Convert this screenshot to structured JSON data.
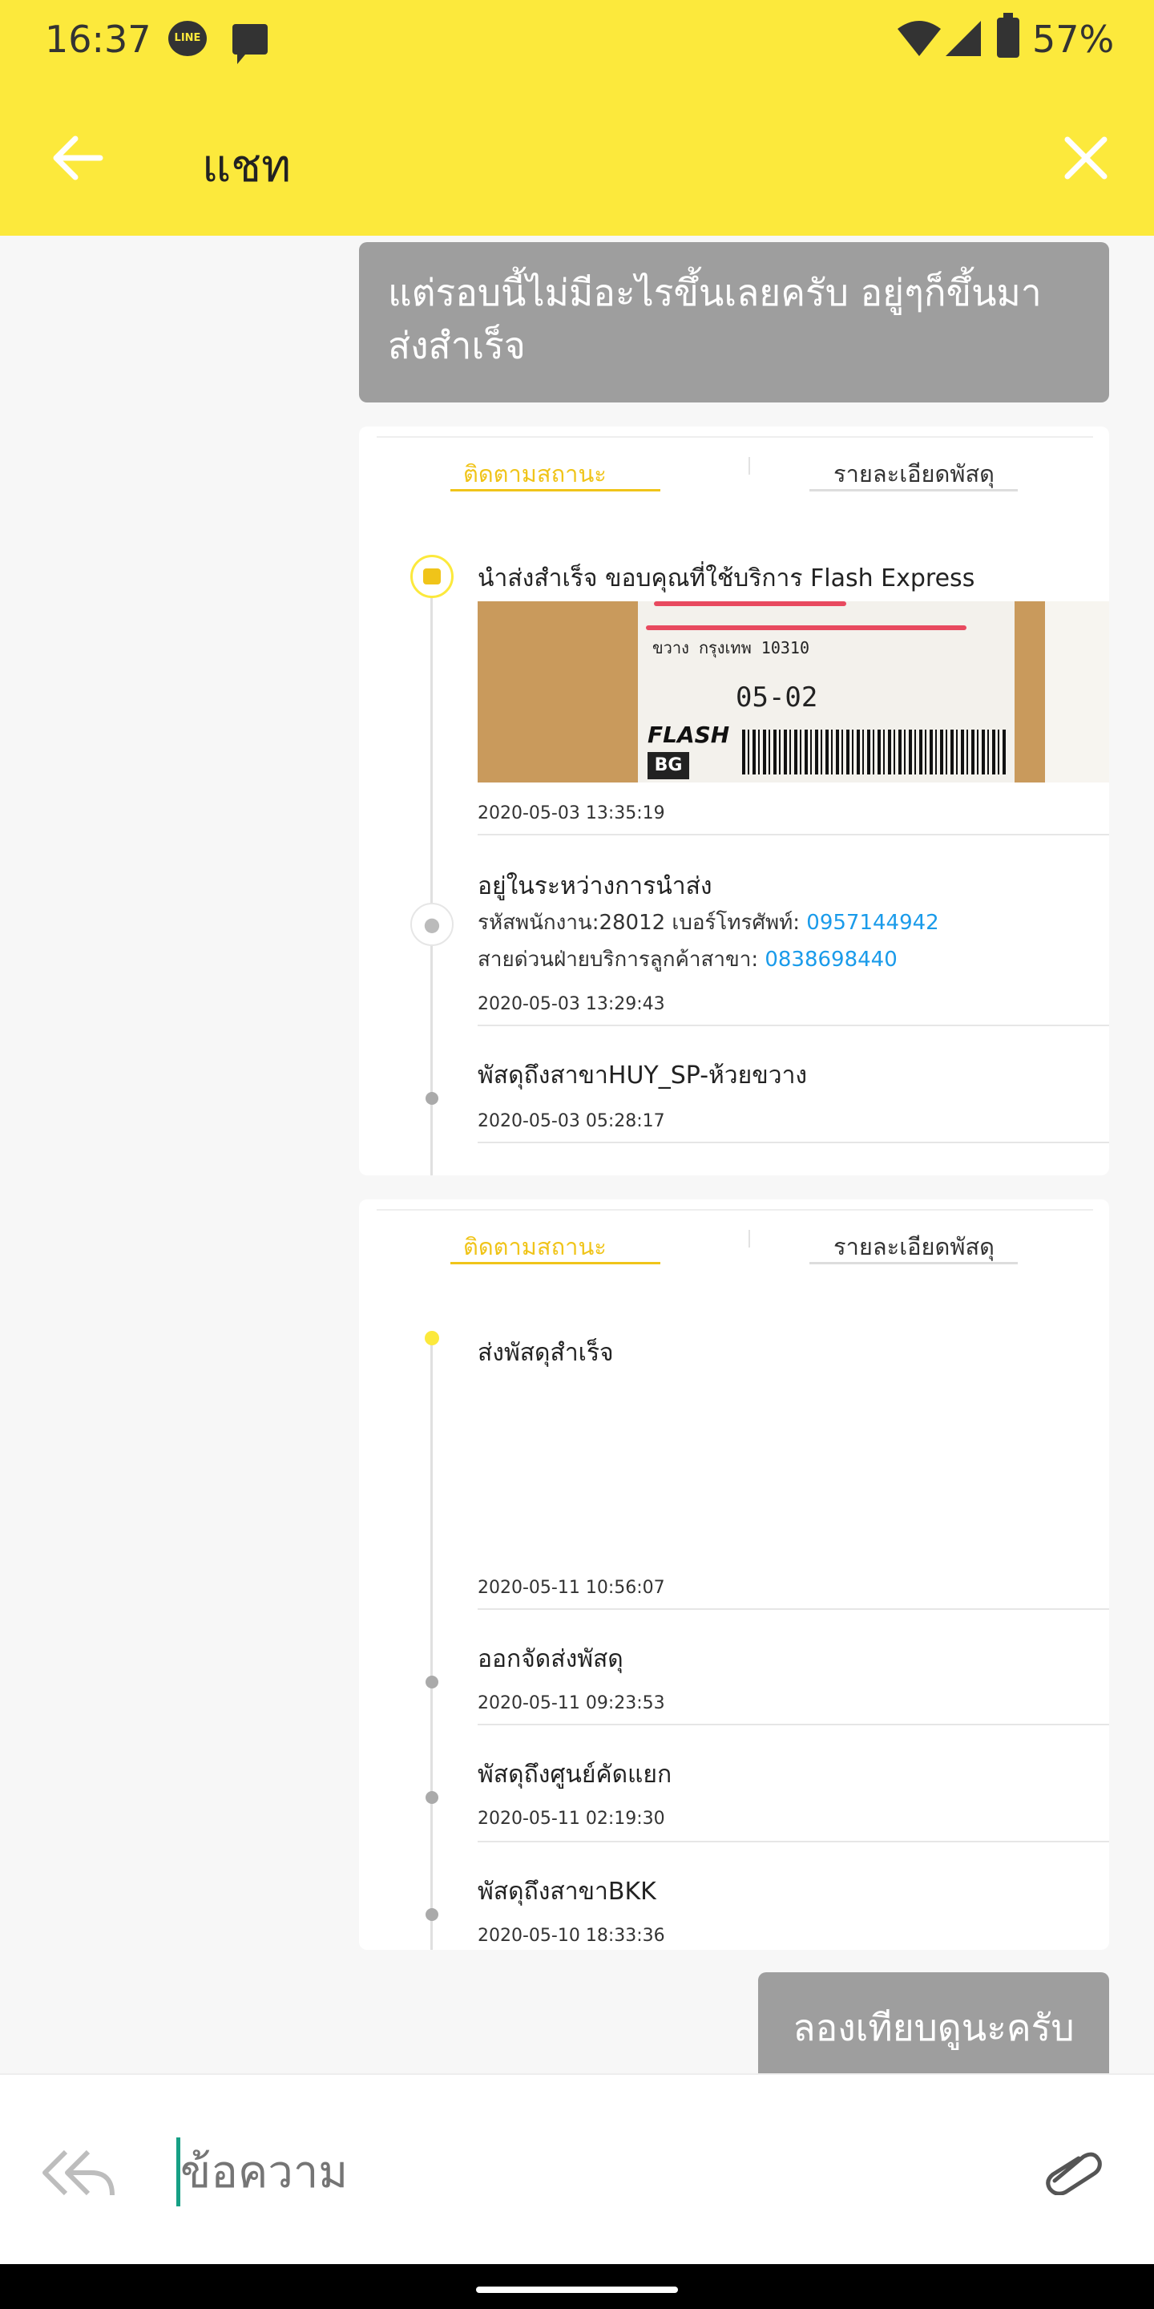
{
  "status_bar": {
    "time": "16:37",
    "battery_pct": "57%",
    "line_badge": "LINE"
  },
  "header": {
    "title": "แชท",
    "back_icon": "arrow-left-icon",
    "close_icon": "close-icon"
  },
  "messages": {
    "first": "แต่รอบนี้ไม่มีอะไรขึ้นเลยครับ อยู่ๆก็ขึ้นมาส่งสำเร็จ",
    "last": "ลองเทียบดูนะครับ"
  },
  "card1": {
    "tabs": [
      "ติดตามสถานะ",
      "รายละเอียดพัสดุ"
    ],
    "events": [
      {
        "title": "นำส่งสำเร็จ ขอบคุณที่ใช้บริการ Flash Express",
        "time": "2020-05-03 13:35:19"
      },
      {
        "title": "อยู่ในระหว่างการนำส่ง",
        "staff_label": "รหัสพนักงาน:28012  เบอร์โทรศัพท์:",
        "staff_phone": "0957144942",
        "hotline_label": "สายด่วนฝ่ายบริการลูกค้าสาขา:",
        "hotline_phone": "0838698440",
        "time": "2020-05-03 13:29:43"
      },
      {
        "title": "พัสดุถึงสาขาHUY_SP-ห้วยขวาง",
        "time": "2020-05-03 05:28:17"
      }
    ],
    "photo": {
      "address_line": "ขวาง กรุงเทพ  10310",
      "pickup_code": "05-02",
      "brand": "FLASH",
      "bg_badge": "BG"
    }
  },
  "card2": {
    "tabs": [
      "ติดตามสถานะ",
      "รายละเอียดพัสดุ"
    ],
    "events": [
      {
        "title": "ส่งพัสดุสำเร็จ",
        "time": "2020-05-11 10:56:07"
      },
      {
        "title": "ออกจัดส่งพัสดุ",
        "time": "2020-05-11 09:23:53"
      },
      {
        "title": "พัสดุถึงศูนย์คัดแยก",
        "time": "2020-05-11 02:19:30"
      },
      {
        "title": "พัสดุถึงสาขาBKK",
        "time": "2020-05-10 18:33:36"
      }
    ]
  },
  "composer": {
    "placeholder": "ข้อความ",
    "reply_icon": "reply-all-icon",
    "attach_icon": "paperclip-icon"
  },
  "colors": {
    "brand_yellow": "#fce93c",
    "tab_active": "#f0c419",
    "link_blue": "#1a9bea",
    "bubble_grey": "#9e9e9e"
  }
}
